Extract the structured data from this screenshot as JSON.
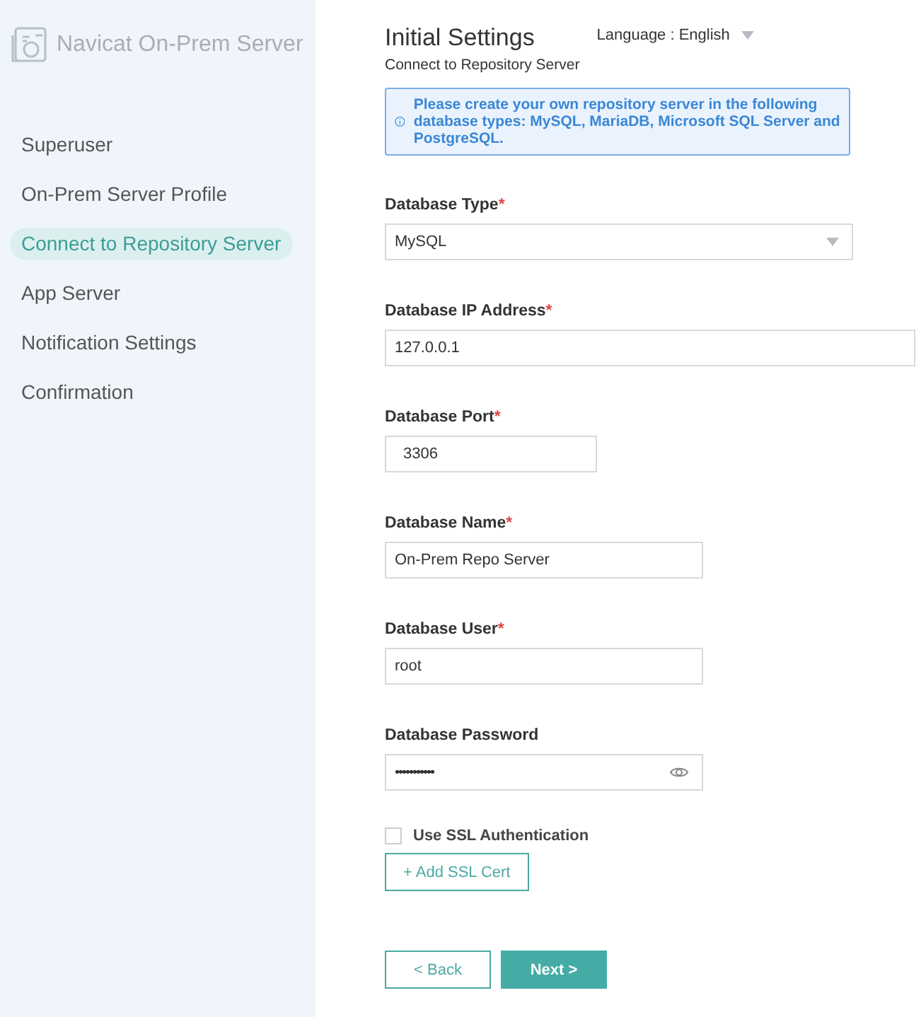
{
  "sidebar": {
    "logo_text": "Navicat On-Prem Server",
    "items": [
      {
        "label": "Superuser",
        "selected": false
      },
      {
        "label": "On-Prem Server Profile",
        "selected": false
      },
      {
        "label": "Connect to Repository Server",
        "selected": true
      },
      {
        "label": "App Server",
        "selected": false
      },
      {
        "label": "Notification Settings",
        "selected": false
      },
      {
        "label": "Confirmation",
        "selected": false
      }
    ]
  },
  "header": {
    "title": "Initial Settings",
    "subtitle": "Connect to Repository Server",
    "language": "Language : English"
  },
  "info": "Please create your own repository server in the following database types: MySQL, MariaDB, Microsoft SQL Server and PostgreSQL.",
  "fields": [
    {
      "kind": "select",
      "label": "Database Type",
      "required_mark": "*",
      "value": "MySQL"
    },
    {
      "kind": "text",
      "label": "Database IP Address",
      "required_mark": "*",
      "value": "127.0.0.1"
    },
    {
      "kind": "text",
      "label": "Database Port",
      "required_mark": "*",
      "value": "3306"
    },
    {
      "kind": "text",
      "label": "Database Name",
      "required_mark": "*",
      "value": "On-Prem Repo Server"
    },
    {
      "kind": "text",
      "label": "Database User",
      "required_mark": "*",
      "value": "root"
    },
    {
      "kind": "password",
      "label": "Database Password",
      "value": "•••••••••••"
    }
  ],
  "ssl": {
    "label": "Use SSL Authentication",
    "checked": false,
    "button": "+ Add SSL Cert"
  },
  "buttons": {
    "back": "< Back",
    "next": "Next >"
  }
}
